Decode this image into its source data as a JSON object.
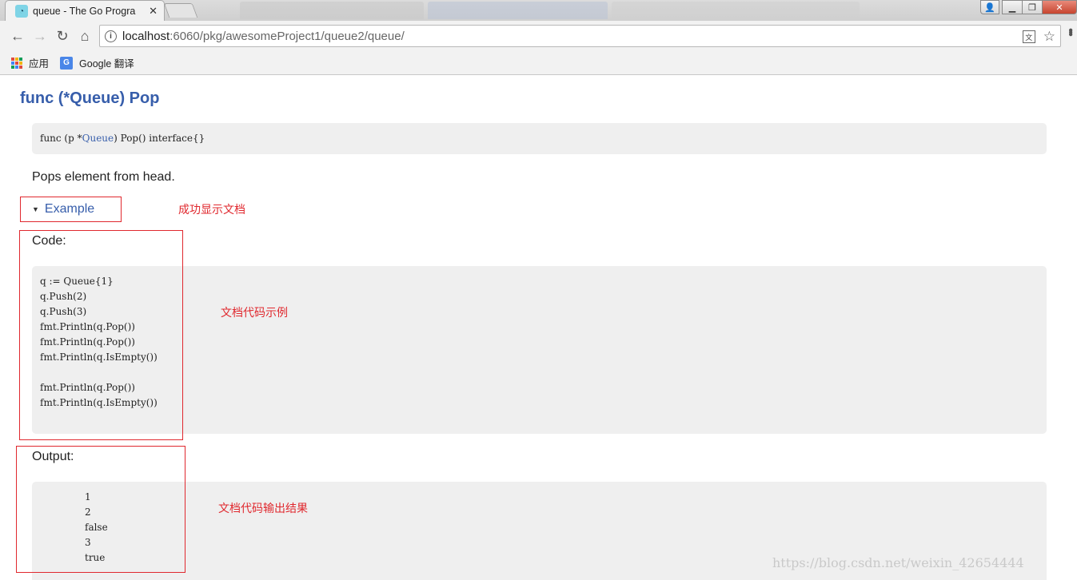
{
  "browser": {
    "tab_title": "queue - The Go Progra",
    "tab_close": "✕",
    "url_host": "localhost",
    "url_rest": ":6060/pkg/awesomeProject1/queue2/queue/",
    "bookmarks": [
      {
        "label": "应用"
      },
      {
        "label": "Google 翻译"
      }
    ]
  },
  "doc": {
    "heading": "func (*Queue) Pop",
    "signature_pre": "func (p *",
    "signature_link": "Queue",
    "signature_post": ") Pop() interface{}",
    "description": "Pops element from head.",
    "example_label": "Example",
    "code_label": "Code:",
    "code_lines": [
      "q := Queue{1}",
      "q.Push(2)",
      "q.Push(3)",
      "fmt.Println(q.Pop())",
      "fmt.Println(q.Pop())",
      "fmt.Println(q.IsEmpty())",
      "",
      "fmt.Println(q.Pop())",
      "fmt.Println(q.IsEmpty())"
    ],
    "output_label": "Output:",
    "output_lines": [
      "1",
      "2",
      "false",
      "3",
      "true"
    ]
  },
  "annotations": {
    "example_note": "成功显示文档",
    "code_note": "文档代码示例",
    "output_note": "文档代码输出结果"
  },
  "watermark": "https://blog.csdn.net/weixin_42654444",
  "colors": {
    "link": "#375eab",
    "annotation": "#e0282e",
    "code_bg": "#efefef"
  }
}
